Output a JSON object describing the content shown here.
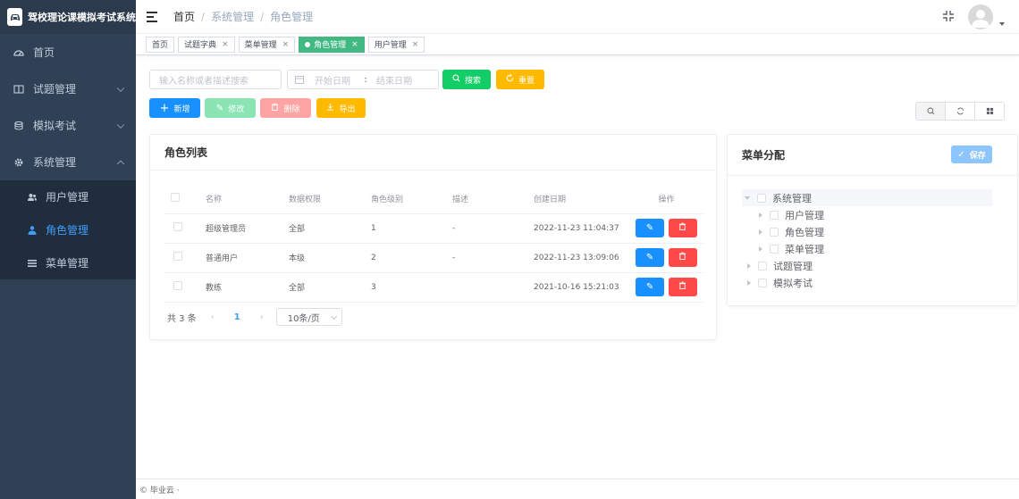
{
  "app": {
    "title": "驾校理论课模拟考试系统"
  },
  "sidebar": {
    "items": [
      {
        "label": "首页"
      },
      {
        "label": "试题管理"
      },
      {
        "label": "模拟考试"
      },
      {
        "label": "系统管理"
      }
    ],
    "sub_items": [
      {
        "label": "用户管理"
      },
      {
        "label": "角色管理"
      },
      {
        "label": "菜单管理"
      }
    ],
    "active_color": "#409eff"
  },
  "breadcrumb": [
    "首页",
    "系统管理",
    "角色管理"
  ],
  "tags": [
    {
      "label": "首页",
      "closable": false
    },
    {
      "label": "试题字典",
      "closable": true
    },
    {
      "label": "菜单管理",
      "closable": true
    },
    {
      "label": "角色管理",
      "closable": true,
      "active": true
    },
    {
      "label": "用户管理",
      "closable": true
    }
  ],
  "search": {
    "name_placeholder": "输入名称或者描述搜索",
    "start_placeholder": "开始日期",
    "range_sep": ":",
    "end_placeholder": "结束日期",
    "search_label": "搜索",
    "reset_label": "重置"
  },
  "toolbar": {
    "add_label": "新增",
    "edit_label": "修改",
    "delete_label": "删除",
    "export_label": "导出"
  },
  "role_table": {
    "title": "角色列表",
    "columns": [
      "名称",
      "数据权限",
      "角色级别",
      "描述",
      "创建日期",
      "操作"
    ],
    "rows": [
      {
        "name": "超级管理员",
        "scope": "全部",
        "level": "1",
        "desc": "-",
        "created": "2022-11-23 11:04:37"
      },
      {
        "name": "普通用户",
        "scope": "本级",
        "level": "2",
        "desc": "-",
        "created": "2022-11-23 13:09:06"
      },
      {
        "name": "教练",
        "scope": "全部",
        "level": "3",
        "desc": "",
        "created": "2021-10-16 15:21:03"
      }
    ]
  },
  "pagination": {
    "total_text": "共 3 条",
    "current_page": "1",
    "page_size": "10条/页"
  },
  "menu_panel": {
    "title": "菜单分配",
    "save_label": "保存",
    "tree": [
      {
        "label": "系统管理",
        "children": [
          "用户管理",
          "角色管理",
          "菜单管理"
        ]
      },
      {
        "label": "试题管理",
        "children": []
      },
      {
        "label": "模拟考试",
        "children": []
      }
    ]
  },
  "colors": {
    "primary": "#1890ff",
    "success": "#13ce66",
    "warning": "#ffba00",
    "danger": "#ff4949",
    "sidebar": "#304156"
  },
  "footer": {
    "text": "© 毕业云 ·"
  }
}
